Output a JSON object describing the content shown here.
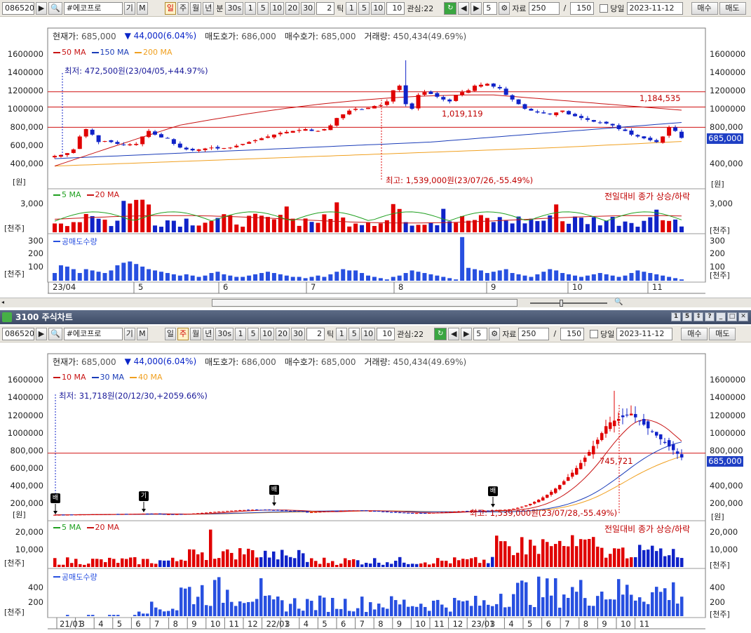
{
  "toolbar": {
    "code": "086520",
    "name": "#에코프로",
    "name_btns": [
      "기",
      "M"
    ],
    "periods": [
      "일",
      "주",
      "월",
      "년",
      "분"
    ],
    "sec_btn": "30s",
    "minute_btns": [
      "1",
      "5",
      "10",
      "20",
      "30"
    ],
    "tick_value": "2",
    "tick_label": "틱",
    "tick_btns": [
      "1",
      "5",
      "10"
    ],
    "tick_count": "10",
    "watch_label": "관심:22",
    "step_value": "5",
    "data_label": "자료",
    "data_count": "250",
    "slash": "/",
    "data_total": "150",
    "today_label": "당일",
    "date": "2023-11-12",
    "buy_btn": "매수",
    "sell_btn": "매도"
  },
  "chart1": {
    "info": {
      "current_label": "현재가:",
      "current": "685,000",
      "change": "▼ 44,000(6.04%)",
      "ask_label": "매도호가:",
      "ask": "686,000",
      "bid_label": "매수호가:",
      "bid": "685,000",
      "volume_label": "거래량:",
      "volume": "450,434(49.69%)"
    },
    "legend": [
      "50 MA",
      "150 MA",
      "200 MA"
    ],
    "low_note": "최저: 472,500원(23/04/05,+44.97%)",
    "high_note": "최고: 1,539,000원(23/07/26,-55.49%)",
    "line_labels": [
      "1,184,535",
      "1,019,119"
    ],
    "price_box": "685,000",
    "y_ticks": [
      "1600000",
      "1400000",
      "1200000",
      "1000000",
      "800,000",
      "600,000",
      "400,000"
    ],
    "y_unit": "[원]",
    "vol_legend": [
      "5 MA",
      "20 MA"
    ],
    "vol_note": "전일대비 종가 상승/하락",
    "vol_tick": "3,000",
    "vol_unit": "[천주]",
    "short_legend": "공매도수량",
    "short_ticks": [
      "300",
      "200",
      "100"
    ],
    "short_unit": "[천주]",
    "x_ticks": [
      "23/04",
      "5",
      "6",
      "7",
      "8",
      "9",
      "10",
      "11"
    ]
  },
  "window2": {
    "title": "3100 주식차트",
    "win_btns": [
      "1",
      "5",
      "↕",
      "?",
      "_",
      "□",
      "✕"
    ]
  },
  "chart2": {
    "info": {
      "current_label": "현재가:",
      "current": "685,000",
      "change": "▼ 44,000(6.04%)",
      "ask_label": "매도호가:",
      "ask": "686,000",
      "bid_label": "매수호가:",
      "bid": "685,000",
      "volume_label": "거래량:",
      "volume": "450,434(49.69%)"
    },
    "legend": [
      "10 MA",
      "30 MA",
      "40 MA"
    ],
    "low_note": "최저: 31,718원(20/12/30,+2059.66%)",
    "high_note": "최고: 1,539,000원(23/07/28,-55.49%)",
    "line_label": "745,721",
    "price_box": "685,000",
    "y_ticks": [
      "1600000",
      "1400000",
      "1200000",
      "1000000",
      "800,000",
      "600,000",
      "400,000",
      "200,000"
    ],
    "y_unit": "[원]",
    "markers": [
      "배",
      "기",
      "배",
      "배"
    ],
    "vol_legend": [
      "5 MA",
      "20 MA"
    ],
    "vol_note": "전일대비 종가 상승/하락",
    "vol_ticks": [
      "20,000",
      "10,000"
    ],
    "vol_unit": "[천주]",
    "short_legend": "공매도수량",
    "short_ticks": [
      "400",
      "200"
    ],
    "short_unit": "[천주]",
    "x_ticks": [
      "21/01",
      "3",
      "4",
      "5",
      "6",
      "7",
      "8",
      "9",
      "10",
      "11",
      "12",
      "22/01",
      "3",
      "4",
      "5",
      "6",
      "7",
      "8",
      "9",
      "10",
      "11",
      "12",
      "23/01",
      "3",
      "4",
      "5",
      "6",
      "7",
      "8",
      "9",
      "10",
      "11"
    ]
  },
  "colors": {
    "up": "#e00000",
    "down": "#1023c8",
    "ma_red": "#c81414",
    "ma_blue": "#1a3cb8",
    "ma_orange": "#f0a020",
    "ma_green": "#20a020",
    "hline": "#d01010",
    "short": "#2850e0"
  },
  "chart_data": [
    {
      "type": "candlestick",
      "title": "",
      "period": "daily",
      "x_range": [
        "23/04",
        "11"
      ],
      "ylim": [
        400000,
        1600000
      ],
      "current_price": 685000,
      "low": {
        "price": 472500,
        "date": "23/04/05"
      },
      "high": {
        "price": 1539000,
        "date": "23/07/26"
      },
      "hlines": [
        1184535,
        1019119,
        800000
      ],
      "close": [
        490000,
        500000,
        520000,
        560000,
        700000,
        780000,
        720000,
        640000,
        650000,
        640000,
        620000,
        610000,
        615000,
        620000,
        700000,
        760000,
        720000,
        690000,
        680000,
        620000,
        580000,
        560000,
        550000,
        560000,
        570000,
        580000,
        570000,
        575000,
        580000,
        600000,
        620000,
        640000,
        660000,
        680000,
        700000,
        720000,
        740000,
        750000,
        760000,
        770000,
        780000,
        760000,
        760000,
        780000,
        820000,
        900000,
        940000,
        980000,
        1000000,
        990000,
        1010000,
        1030000,
        1040000,
        1080000,
        1200000,
        1250000,
        1050000,
        1000000,
        1150000,
        1180000,
        1160000,
        1130000,
        1100000,
        1080000,
        1150000,
        1180000,
        1200000,
        1250000,
        1260000,
        1270000,
        1240000,
        1220000,
        1150000,
        1100000,
        1050000,
        1000000,
        980000,
        960000,
        950000,
        940000,
        960000,
        980000,
        940000,
        920000,
        900000,
        880000,
        860000,
        850000,
        840000,
        820000,
        780000,
        760000,
        720000,
        700000,
        680000,
        660000,
        640000,
        700000,
        800000,
        760000,
        685000
      ],
      "ma": [
        {
          "name": "50 MA"
        },
        {
          "name": "150 MA"
        },
        {
          "name": "200 MA"
        }
      ]
    },
    {
      "type": "bar",
      "title": "",
      "series": [
        {
          "name": "공매도수량"
        }
      ],
      "ylim": [
        0,
        350
      ],
      "values": [
        60,
        120,
        110,
        90,
        60,
        90,
        80,
        70,
        60,
        80,
        120,
        140,
        150,
        130,
        110,
        90,
        80,
        70,
        60,
        50,
        40,
        50,
        40,
        30,
        40,
        60,
        70,
        50,
        40,
        30,
        30,
        40,
        50,
        60,
        70,
        60,
        50,
        40,
        30,
        30,
        20,
        30,
        40,
        30,
        50,
        70,
        90,
        80,
        80,
        60,
        40,
        30,
        20,
        10,
        30,
        40,
        60,
        80,
        70,
        60,
        50,
        40,
        30,
        20,
        10,
        340,
        100,
        90,
        80,
        60,
        70,
        80,
        90,
        60,
        50,
        40,
        30,
        50,
        70,
        90,
        80,
        60,
        50,
        40,
        30,
        40,
        50,
        60,
        50,
        40,
        30,
        40,
        60,
        80,
        70,
        60,
        50,
        40,
        30,
        20,
        10
      ]
    },
    {
      "type": "candlestick",
      "title": "",
      "period": "weekly",
      "x_range": [
        "21/01",
        "11"
      ],
      "ylim": [
        0,
        1600000
      ],
      "current_price": 685000,
      "low": {
        "price": 31718,
        "date": "20/12/30"
      },
      "high": {
        "price": 1539000,
        "date": "23/07/28"
      },
      "hlines": [
        745721
      ],
      "ma": [
        {
          "name": "10 MA"
        },
        {
          "name": "30 MA"
        },
        {
          "name": "40 MA"
        }
      ]
    }
  ]
}
